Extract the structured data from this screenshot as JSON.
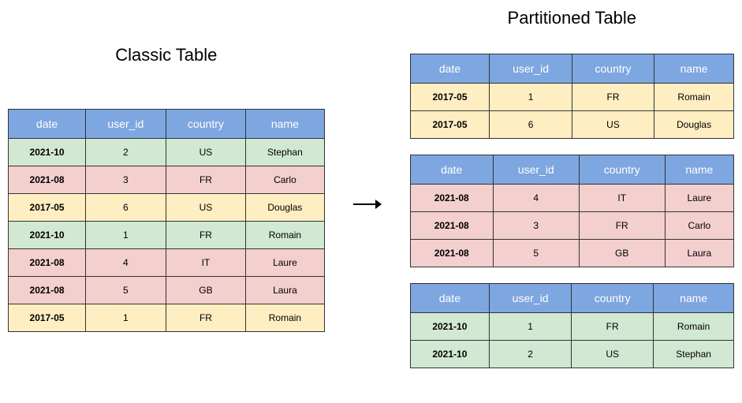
{
  "titles": {
    "left": "Classic Table",
    "right": "Partitioned Table"
  },
  "headers": [
    "date",
    "user_id",
    "country",
    "name"
  ],
  "colors": {
    "2017-05": "row-yellow",
    "2021-08": "row-pink",
    "2021-10": "row-green"
  },
  "classic_rows": [
    {
      "date": "2021-10",
      "user_id": "2",
      "country": "US",
      "name": "Stephan"
    },
    {
      "date": "2021-08",
      "user_id": "3",
      "country": "FR",
      "name": "Carlo"
    },
    {
      "date": "2017-05",
      "user_id": "6",
      "country": "US",
      "name": "Douglas"
    },
    {
      "date": "2021-10",
      "user_id": "1",
      "country": "FR",
      "name": "Romain"
    },
    {
      "date": "2021-08",
      "user_id": "4",
      "country": "IT",
      "name": "Laure"
    },
    {
      "date": "2021-08",
      "user_id": "5",
      "country": "GB",
      "name": "Laura"
    },
    {
      "date": "2017-05",
      "user_id": "1",
      "country": "FR",
      "name": "Romain"
    }
  ],
  "partitions": [
    [
      {
        "date": "2017-05",
        "user_id": "1",
        "country": "FR",
        "name": "Romain"
      },
      {
        "date": "2017-05",
        "user_id": "6",
        "country": "US",
        "name": "Douglas"
      }
    ],
    [
      {
        "date": "2021-08",
        "user_id": "4",
        "country": "IT",
        "name": "Laure"
      },
      {
        "date": "2021-08",
        "user_id": "3",
        "country": "FR",
        "name": "Carlo"
      },
      {
        "date": "2021-08",
        "user_id": "5",
        "country": "GB",
        "name": "Laura"
      }
    ],
    [
      {
        "date": "2021-10",
        "user_id": "1",
        "country": "FR",
        "name": "Romain"
      },
      {
        "date": "2021-10",
        "user_id": "2",
        "country": "US",
        "name": "Stephan"
      }
    ]
  ]
}
